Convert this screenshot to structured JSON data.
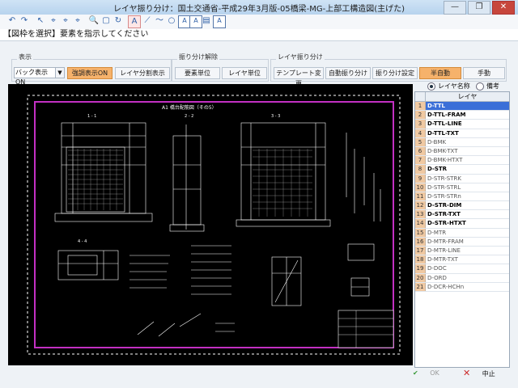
{
  "window": {
    "title": "レイヤ振り分け：国土交通省-平成29年3月版-05橋梁-MG-上部工構造図(主げた)"
  },
  "window_buttons": [
    "—",
    "❐",
    "✕"
  ],
  "toolbar": {
    "icons": [
      "undo-icon",
      "redo-icon",
      "pointer-icon",
      "lasso-select-icon",
      "lasso-add-icon",
      "lasso-remove-icon",
      "zoom-icon",
      "page-icon",
      "refresh-icon",
      "text-icon",
      "line-tool-icon",
      "polyline-tool-icon",
      "circle-tool-icon",
      "text-a-icon",
      "text-a2-icon",
      "image-tool-icon",
      "text-a3-icon"
    ],
    "glyphs": [
      "↶",
      "↷",
      "↖",
      "⌖",
      "⌖",
      "⌖",
      "🔍",
      "▢",
      "↻",
      "A",
      "⟋",
      "〜",
      "○",
      "A",
      "A",
      "▤",
      "A"
    ]
  },
  "prompt": {
    "text": "【図枠を選択】要素を指示してください"
  },
  "groups": {
    "display": {
      "label": "表示",
      "select_value": "バック表示ON",
      "buttons": [
        "強調表示ON",
        "レイヤ分割表示"
      ]
    },
    "cancel": {
      "label": "振り分け解除",
      "buttons": [
        "要素単位",
        "レイヤ単位"
      ]
    },
    "assign": {
      "label": "レイヤ振り分け",
      "buttons": [
        "テンプレート変更",
        "自動振り分け",
        "振り分け設定",
        "半自動",
        "手動"
      ]
    }
  },
  "drawing": {
    "title": "A1 橋台配筋図（その5）",
    "sections": [
      "1 - 1",
      "2 - 2",
      "3 - 3",
      "4 - 4"
    ]
  },
  "layer_panel": {
    "radio_name": "レイヤ名称",
    "radio_note": "備考",
    "header": "レイヤ",
    "layers": [
      {
        "num": "1",
        "name": "D-TTL",
        "bold": true
      },
      {
        "num": "2",
        "name": "D-TTL-FRAM",
        "bold": true
      },
      {
        "num": "3",
        "name": "D-TTL-LINE",
        "bold": true
      },
      {
        "num": "4",
        "name": "D-TTL-TXT",
        "bold": true
      },
      {
        "num": "5",
        "name": "D-BMK",
        "bold": false
      },
      {
        "num": "6",
        "name": "D-BMK-TXT",
        "bold": false
      },
      {
        "num": "7",
        "name": "D-BMK-HTXT",
        "bold": false
      },
      {
        "num": "8",
        "name": "D-STR",
        "bold": true
      },
      {
        "num": "9",
        "name": "D-STR-STRK",
        "bold": false
      },
      {
        "num": "10",
        "name": "D-STR-STRL",
        "bold": false
      },
      {
        "num": "11",
        "name": "D-STR-STRn",
        "bold": false
      },
      {
        "num": "12",
        "name": "D-STR-DIM",
        "bold": true
      },
      {
        "num": "13",
        "name": "D-STR-TXT",
        "bold": true
      },
      {
        "num": "14",
        "name": "D-STR-HTXT",
        "bold": true
      },
      {
        "num": "15",
        "name": "D-MTR",
        "bold": false
      },
      {
        "num": "16",
        "name": "D-MTR-FRAM",
        "bold": false
      },
      {
        "num": "17",
        "name": "D-MTR-LINE",
        "bold": false
      },
      {
        "num": "18",
        "name": "D-MTR-TXT",
        "bold": false
      },
      {
        "num": "19",
        "name": "D-DOC",
        "bold": false
      },
      {
        "num": "20",
        "name": "D-ORD",
        "bold": false
      },
      {
        "num": "21",
        "name": "D-DCR-HCHn",
        "bold": false
      }
    ]
  },
  "footer": {
    "ok_label": "OK",
    "cancel_label": "中止"
  }
}
